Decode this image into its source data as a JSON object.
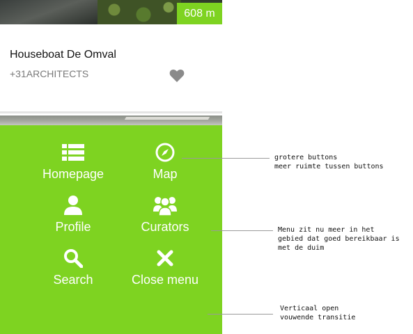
{
  "card": {
    "distance": "608 m",
    "title": "Houseboat De Omval",
    "subtitle": "+31ARCHITECTS"
  },
  "menu": {
    "items": [
      {
        "label": "Homepage",
        "icon": "list-icon"
      },
      {
        "label": "Map",
        "icon": "compass-icon"
      },
      {
        "label": "Profile",
        "icon": "user-icon"
      },
      {
        "label": "Curators",
        "icon": "group-icon"
      },
      {
        "label": "Search",
        "icon": "search-icon"
      },
      {
        "label": "Close menu",
        "icon": "close-icon"
      }
    ]
  },
  "annotations": [
    {
      "text": "grotere buttons\nmeer ruimte tussen buttons"
    },
    {
      "text": "Menu zit nu meer in het\ngebied dat goed bereikbaar is\nmet de duim"
    },
    {
      "text": "Verticaal open\nvouwende transitie"
    }
  ],
  "colors": {
    "accent": "#7ed321",
    "heart": "#8a8a8a",
    "subtitle": "#7a7a7a"
  }
}
